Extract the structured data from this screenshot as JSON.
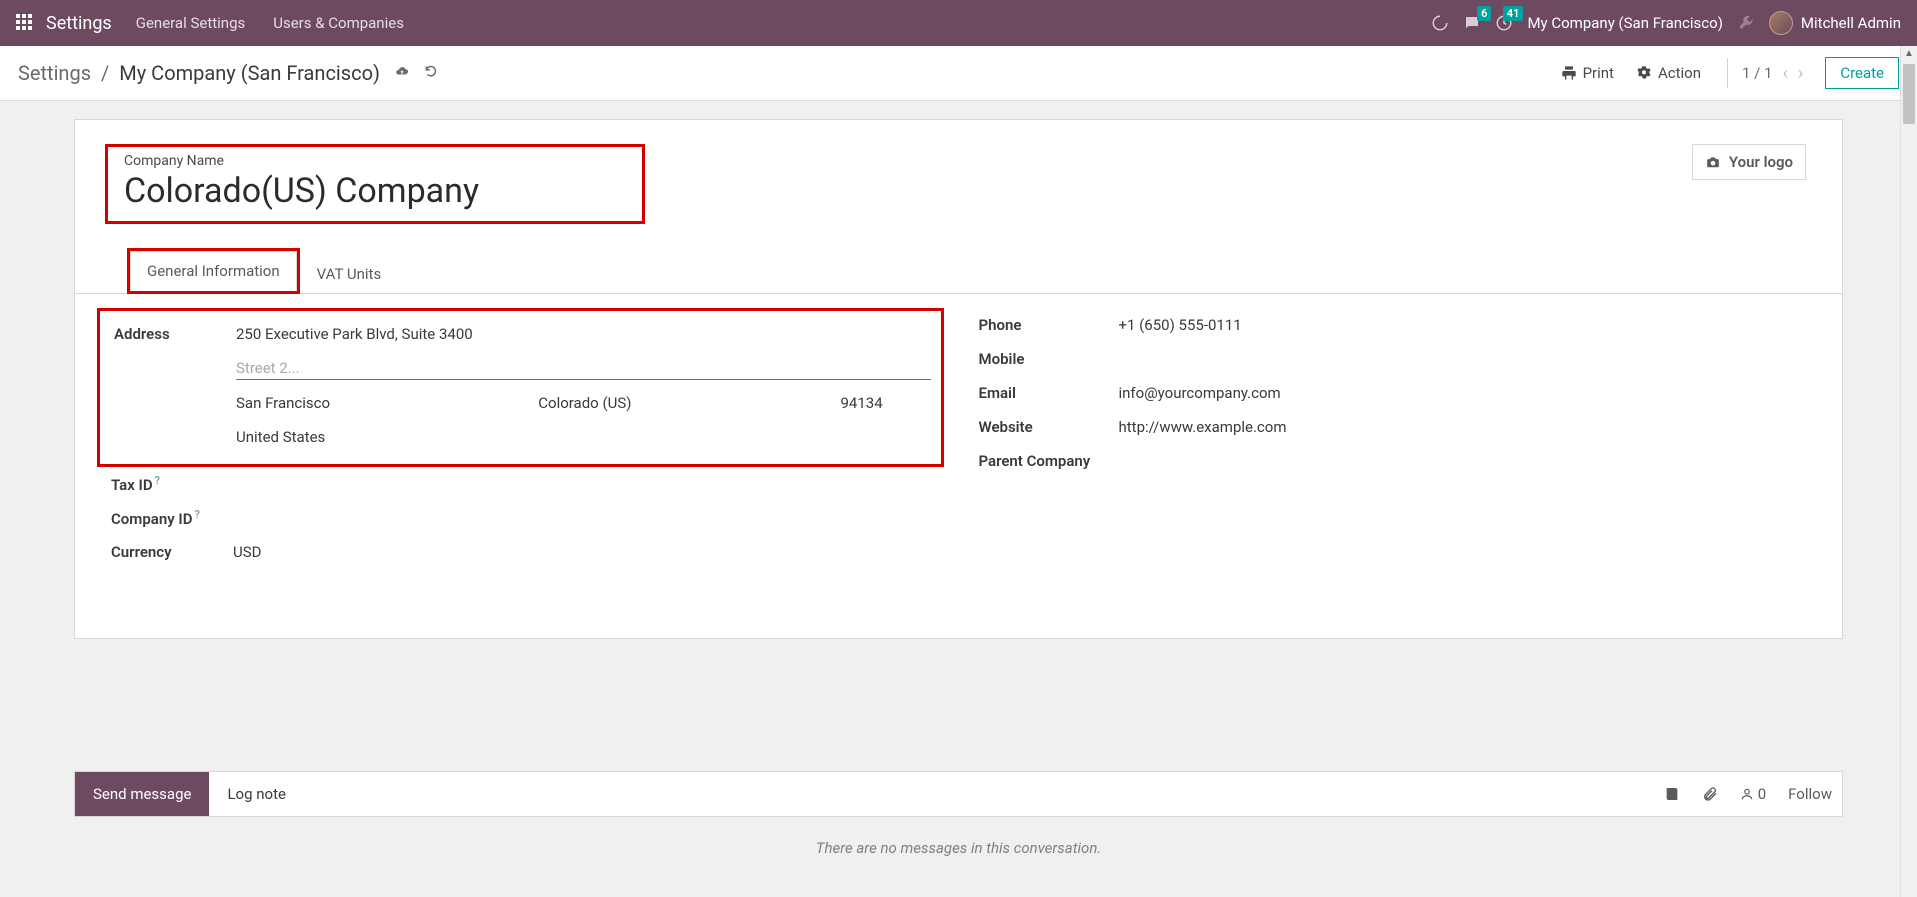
{
  "topnav": {
    "brand": "Settings",
    "menu": {
      "general": "General Settings",
      "users": "Users & Companies"
    },
    "badges": {
      "chat": "6",
      "clock": "41"
    },
    "company": "My Company (San Francisco)",
    "user": "Mitchell Admin"
  },
  "controlbar": {
    "breadcrumb_root": "Settings",
    "breadcrumb_sep": "/",
    "breadcrumb_current": "My Company (San Francisco)",
    "print": "Print",
    "action": "Action",
    "pager": "1 / 1",
    "create": "Create"
  },
  "card": {
    "name_label": "Company Name",
    "name_value": "Colorado(US) Company",
    "logo_btn": "Your logo",
    "tabs": {
      "general": "General Information",
      "vat": "VAT Units"
    }
  },
  "left": {
    "address_label": "Address",
    "street1": "250 Executive Park Blvd, Suite 3400",
    "street2_placeholder": "Street 2...",
    "city": "San Francisco",
    "state": "Colorado (US)",
    "zip": "94134",
    "country": "United States",
    "taxid_label": "Tax ID",
    "companyid_label": "Company ID",
    "currency_label": "Currency",
    "currency_value": "USD"
  },
  "right": {
    "phone_label": "Phone",
    "phone_value": "+1 (650) 555-0111",
    "mobile_label": "Mobile",
    "email_label": "Email",
    "email_value": "info@yourcompany.com",
    "website_label": "Website",
    "website_value": "http://www.example.com",
    "parent_label": "Parent Company"
  },
  "footer": {
    "send": "Send message",
    "lognote": "Log note",
    "followers": "0",
    "follow": "Follow",
    "empty": "There are no messages in this conversation."
  }
}
